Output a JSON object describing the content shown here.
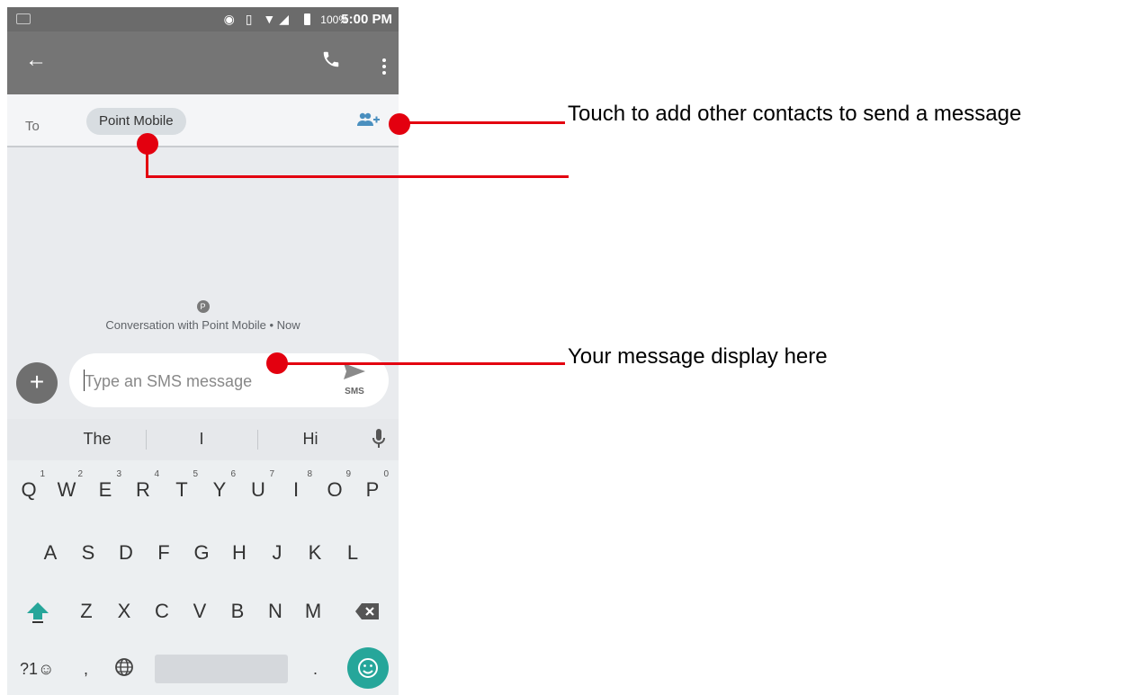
{
  "status_bar": {
    "battery_percent": "100%",
    "time": "5:00 PM"
  },
  "header": {
    "back_icon": "arrow-left-icon",
    "call_icon": "phone-icon",
    "more_icon": "more-vertical-icon"
  },
  "recipient": {
    "to_label": "To",
    "chip_label": "Point Mobile",
    "add_contact_icon": "add-person-icon"
  },
  "conversation": {
    "avatar_letter": "P",
    "info": "Conversation with Point Mobile • Now"
  },
  "composer": {
    "placeholder": "Type an SMS message",
    "send_label": "SMS"
  },
  "suggestions": [
    "The",
    "I",
    "Hi"
  ],
  "keyboard": {
    "row1": [
      "Q",
      "W",
      "E",
      "R",
      "T",
      "Y",
      "U",
      "I",
      "O",
      "P"
    ],
    "row1_hints": [
      "1",
      "2",
      "3",
      "4",
      "5",
      "6",
      "7",
      "8",
      "9",
      "0"
    ],
    "row2": [
      "A",
      "S",
      "D",
      "F",
      "G",
      "H",
      "J",
      "K",
      "L"
    ],
    "row3": [
      "Z",
      "X",
      "C",
      "V",
      "B",
      "N",
      "M"
    ],
    "symbols": "?1☺",
    "comma": ",",
    "period": "."
  },
  "annotations": {
    "add_contacts": "Touch to add other contacts to send a message",
    "message_display": "Your message display here"
  },
  "colors": {
    "accent_red": "#e3000f",
    "emoji_teal": "#26a69a",
    "appbar": "#757575"
  }
}
